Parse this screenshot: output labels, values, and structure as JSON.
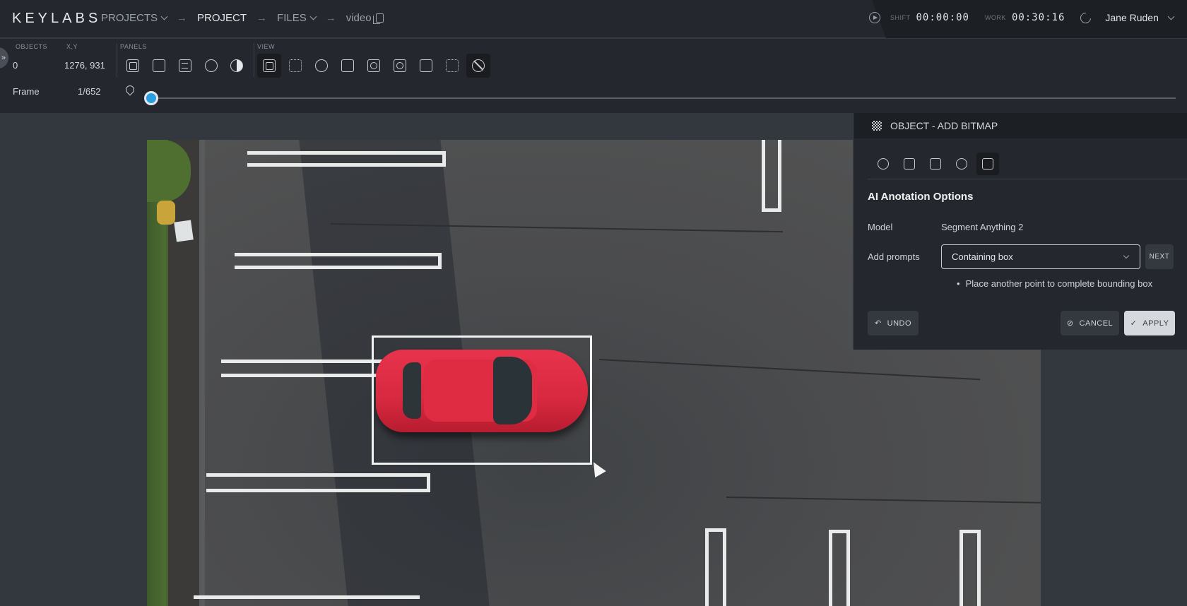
{
  "app": {
    "logo": "KEYLABS"
  },
  "breadcrumb": {
    "projects": "PROJECTS",
    "project": "PROJECT",
    "files": "FILES",
    "video": "video",
    "arrow": "→"
  },
  "timers": {
    "shift_label": "SHIFT",
    "shift_value": "00:00:00",
    "work_label": "WORK",
    "work_value": "00:30:16"
  },
  "user": {
    "name": "Jane Ruden"
  },
  "toolbar": {
    "objects_label": "OBJECTS",
    "objects_value": "0",
    "xy_label": "X,Y",
    "xy_value": "1276, 931",
    "panels_label": "PANELS",
    "view_label": "VIEW",
    "frame_label": "Frame",
    "frame_value": "1/652",
    "frame_progress": 0.0015
  },
  "panel": {
    "title": "OBJECT - ADD BITMAP",
    "section_title": "AI Anotation Options",
    "model_label": "Model",
    "model_value": "Segment Anything 2",
    "prompts_label": "Add prompts",
    "prompts_value": "Containing box",
    "next_label": "NEXT",
    "hint": "Place another point to complete bounding box",
    "undo_label": "UNDO",
    "cancel_label": "CANCEL",
    "apply_label": "APPLY"
  }
}
